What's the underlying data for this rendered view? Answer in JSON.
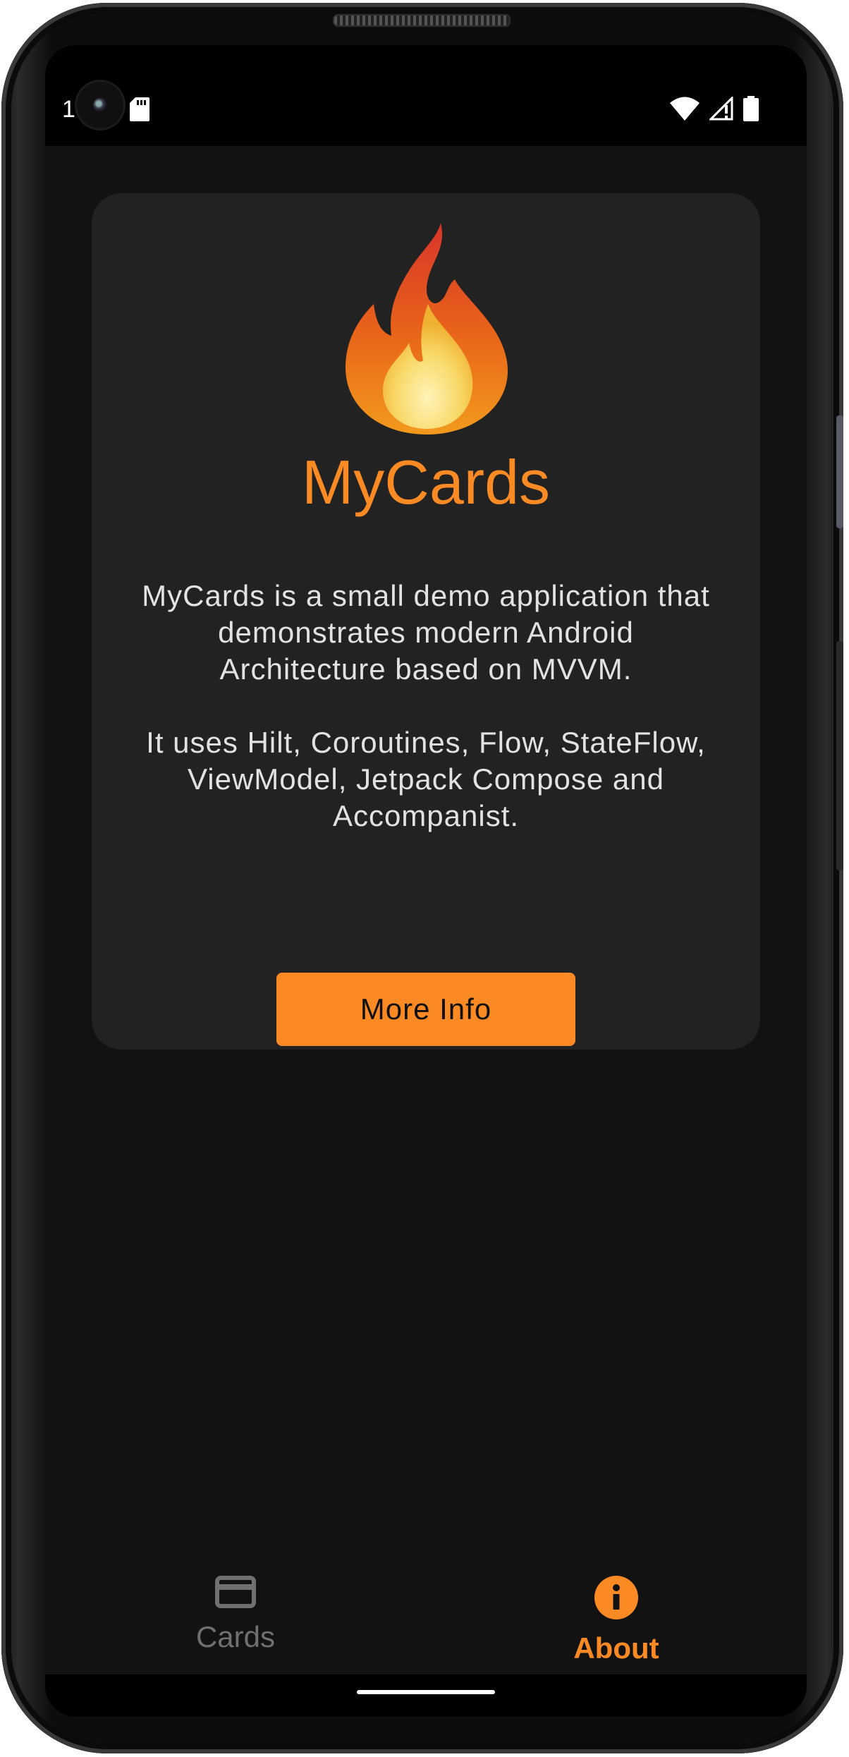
{
  "status_bar": {
    "time": "1"
  },
  "about": {
    "app_title": "MyCards",
    "description_1": "MyCards is a small demo application that demonstrates modern Android Architecture based on MVVM.",
    "description_2": "It uses Hilt, Coroutines, Flow, StateFlow, ViewModel, Jetpack Compose and Accompanist.",
    "more_info_label": "More Info"
  },
  "bottom_nav": {
    "items": [
      {
        "label": "Cards",
        "icon": "credit-card-icon",
        "selected": false
      },
      {
        "label": "About",
        "icon": "info-icon",
        "selected": true
      }
    ]
  },
  "colors": {
    "accent": "#fb8a24",
    "background": "#121212",
    "card": "#222222",
    "inactive": "#707070"
  }
}
